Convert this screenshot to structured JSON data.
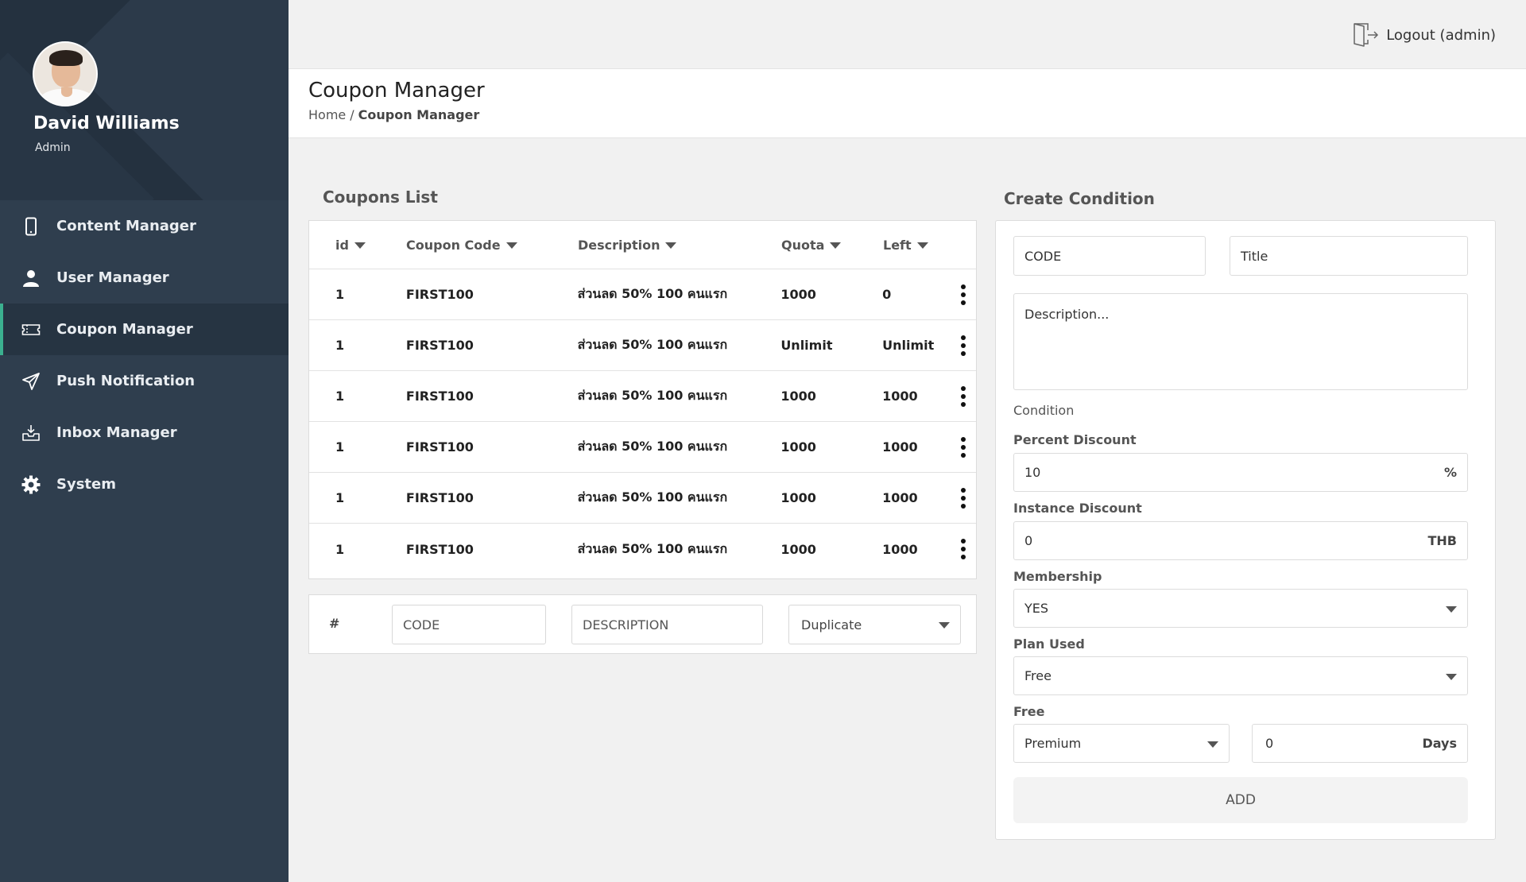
{
  "profile": {
    "name": "David Williams",
    "role": "Admin"
  },
  "nav": [
    {
      "label": "Content Manager",
      "icon": "phone-icon"
    },
    {
      "label": "User Manager",
      "icon": "user-icon"
    },
    {
      "label": "Coupon Manager",
      "icon": "ticket-icon",
      "active": true
    },
    {
      "label": "Push Notification",
      "icon": "paper-plane-icon"
    },
    {
      "label": "Inbox Manager",
      "icon": "inbox-icon"
    },
    {
      "label": "System",
      "icon": "gear-icon"
    }
  ],
  "topbar": {
    "logout_label": "Logout (admin)"
  },
  "header": {
    "title": "Coupon Manager",
    "breadcrumb_home": "Home",
    "breadcrumb_sep": "/",
    "breadcrumb_current": "Coupon Manager"
  },
  "coupons": {
    "title": "Coupons List",
    "columns": [
      "id",
      "Coupon Code",
      "Description",
      "Quota",
      "Left"
    ],
    "rows": [
      {
        "id": "1",
        "code": "FIRST100",
        "description": "ส่วนลด 50% 100 คนแรก",
        "quota": "1000",
        "left": "0"
      },
      {
        "id": "1",
        "code": "FIRST100",
        "description": "ส่วนลด 50% 100 คนแรก",
        "quota": "Unlimit",
        "left": "Unlimit"
      },
      {
        "id": "1",
        "code": "FIRST100",
        "description": "ส่วนลด 50% 100 คนแรก",
        "quota": "1000",
        "left": "1000"
      },
      {
        "id": "1",
        "code": "FIRST100",
        "description": "ส่วนลด 50% 100 คนแรก",
        "quota": "1000",
        "left": "1000"
      },
      {
        "id": "1",
        "code": "FIRST100",
        "description": "ส่วนลด 50% 100 คนแรก",
        "quota": "1000",
        "left": "1000"
      },
      {
        "id": "1",
        "code": "FIRST100",
        "description": "ส่วนลด 50% 100 คนแรก",
        "quota": "1000",
        "left": "1000"
      }
    ],
    "add_row": {
      "hash": "#",
      "code_placeholder": "CODE",
      "description_placeholder": "DESCRIPTION",
      "action_selected": "Duplicate"
    }
  },
  "condition": {
    "title": "Create Condition",
    "code_placeholder": "CODE",
    "title_placeholder": "Title",
    "description_placeholder": "Description...",
    "condition_label": "Condition",
    "percent_label": "Percent Discount",
    "percent_value": "10",
    "percent_suffix": "%",
    "instance_label": "Instance Discount",
    "instance_value": "0",
    "instance_suffix": "THB",
    "membership_label": "Membership",
    "membership_value": "YES",
    "plan_label": "Plan Used",
    "plan_value": "Free",
    "free_label": "Free",
    "free_plan_value": "Premium",
    "free_days_value": "0",
    "free_days_suffix": "Days",
    "add_label": "ADD"
  },
  "colors": {
    "sidebar": "#2f3e4e",
    "sidebar_active": "#263442",
    "accent": "#3bb08f",
    "background": "#f1f1f1"
  }
}
